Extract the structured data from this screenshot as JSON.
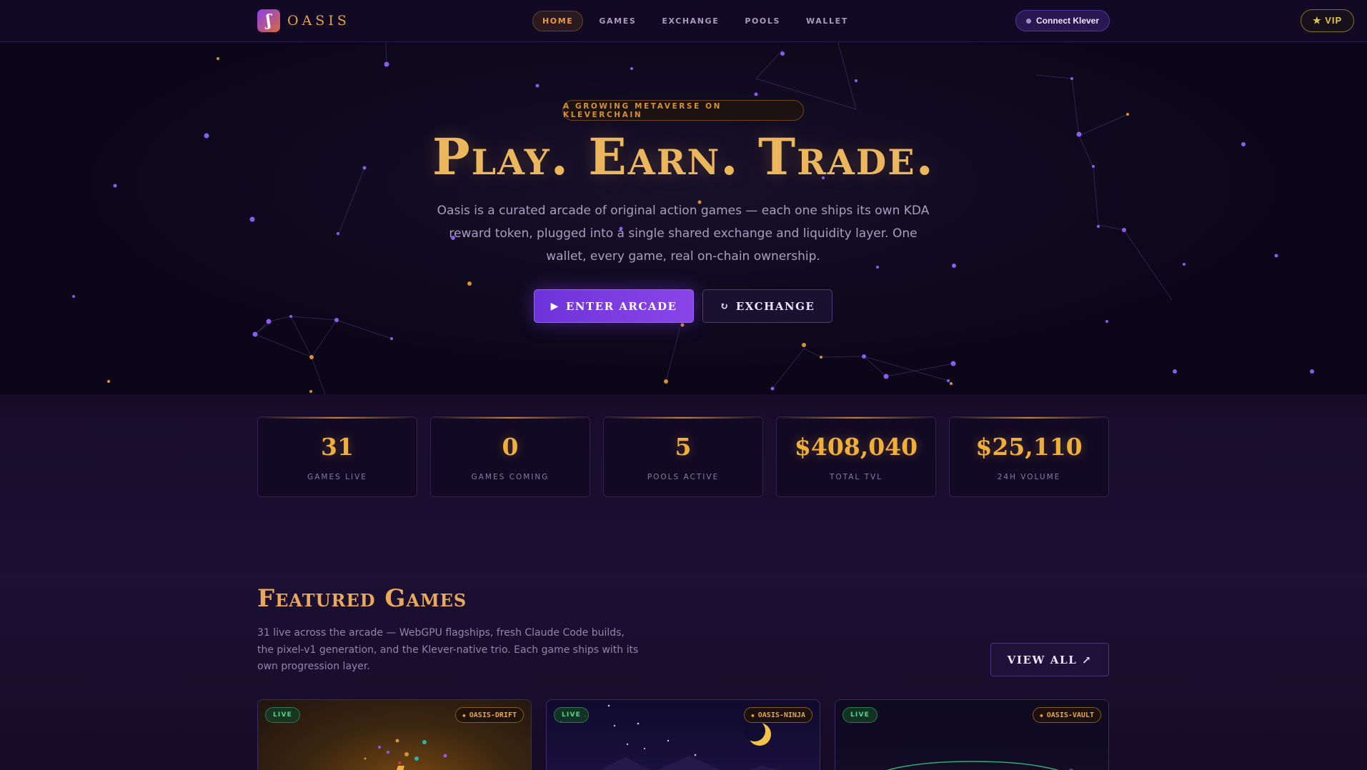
{
  "brand": {
    "logo_glyph": "ʃ",
    "name": "OASIS"
  },
  "nav": {
    "links": [
      "HOME",
      "GAMES",
      "EXCHANGE",
      "POOLS",
      "WALLET"
    ],
    "active": "HOME",
    "connect_label": "Connect Klever",
    "vip_label": "★ VIP"
  },
  "hero": {
    "eyebrow": "A GROWING METAVERSE ON KLEVERCHAIN",
    "title": "Play. Earn. Trade.",
    "description": "Oasis is a curated arcade of original action games — each one ships its own KDA reward token, plugged into a single shared exchange and liquidity layer. One wallet, every game, real on-chain ownership.",
    "primary_icon": "▶",
    "primary_label": "ENTER ARCADE",
    "secondary_icon": "↻",
    "secondary_label": "EXCHANGE"
  },
  "stats": [
    {
      "value": "31",
      "label": "GAMES LIVE"
    },
    {
      "value": "0",
      "label": "GAMES COMING"
    },
    {
      "value": "5",
      "label": "POOLS ACTIVE"
    },
    {
      "value": "$408,040",
      "label": "TOTAL TVL"
    },
    {
      "value": "$25,110",
      "label": "24H VOLUME"
    }
  ],
  "featured": {
    "title": "Featured Games",
    "description": "31 live across the arcade — WebGPU flagships, fresh Claude Code builds, the pixel-v1 generation, and the Klever-native trio. Each game ships with its own progression layer.",
    "view_all_label": "VIEW ALL ↗",
    "cards": [
      {
        "status": "LIVE",
        "token": "OASIS-DRIFT"
      },
      {
        "status": "LIVE",
        "token": "OASIS-NINJA"
      },
      {
        "status": "LIVE",
        "token": "OASIS-VAULT"
      }
    ]
  },
  "colors": {
    "accent_gold": "#ecb65c",
    "accent_purple": "#7c3aed",
    "live_green": "#4fd887",
    "background": "#0b0618"
  },
  "icons": {
    "token_badge": "◆",
    "connect_status": "dot"
  }
}
